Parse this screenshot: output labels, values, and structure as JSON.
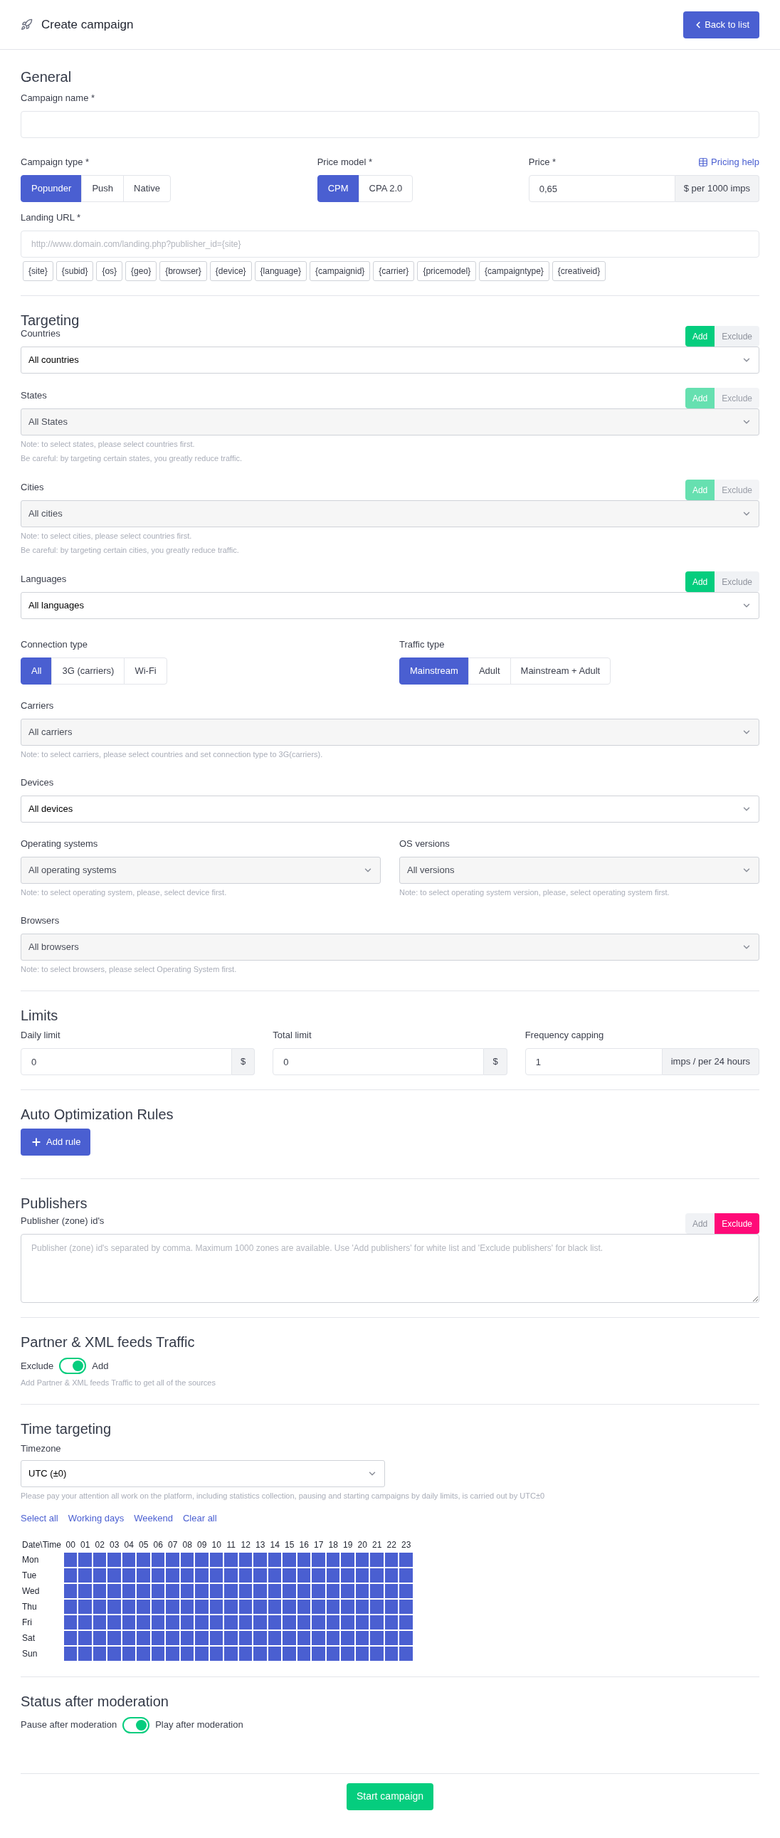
{
  "header": {
    "title": "Create campaign",
    "back_button": "Back to list"
  },
  "general": {
    "heading": "General",
    "campaign_name": {
      "label": "Campaign name *"
    },
    "campaign_type": {
      "label": "Campaign type *",
      "options": [
        {
          "label": "Popunder",
          "selected": true
        },
        {
          "label": "Push",
          "selected": false
        },
        {
          "label": "Native",
          "selected": false
        }
      ]
    },
    "price_model": {
      "label": "Price model *",
      "options": [
        {
          "label": "CPM",
          "selected": true
        },
        {
          "label": "CPA 2.0",
          "selected": false
        }
      ]
    },
    "price": {
      "label": "Price *",
      "help_link": "Pricing help",
      "value": "0,65",
      "suffix": "$ per 1000 imps"
    },
    "landing_url": {
      "label": "Landing URL *",
      "placeholder": "http://www.domain.com/landing.php?publisher_id={site}",
      "macros": [
        "{site}",
        "{subid}",
        "{os}",
        "{geo}",
        "{browser}",
        "{device}",
        "{language}",
        "{campaignid}",
        "{carrier}",
        "{pricemodel}",
        "{campaigntype}",
        "{creativeid}"
      ]
    }
  },
  "targeting": {
    "heading": "Targeting",
    "rows": [
      {
        "kind": "select",
        "label": "Countries",
        "value": "All countries",
        "disabled": false,
        "modes": [
          {
            "label": "Add",
            "selected": true
          },
          {
            "label": "Exclude",
            "selected": false
          }
        ]
      },
      {
        "kind": "select",
        "label": "States",
        "value": "All States",
        "disabled": true,
        "modes": [
          {
            "label": "Add",
            "selected": true
          },
          {
            "label": "Exclude",
            "selected": false
          }
        ],
        "notes": [
          "Note: to select states, please select countries first.",
          "Be careful: by targeting certain states, you greatly reduce traffic."
        ]
      },
      {
        "kind": "select",
        "label": "Cities",
        "value": "All cities",
        "disabled": true,
        "modes": [
          {
            "label": "Add",
            "selected": true
          },
          {
            "label": "Exclude",
            "selected": false
          }
        ],
        "notes": [
          "Note: to select cities, please select countries first.",
          "Be careful: by targeting certain cities, you greatly reduce traffic."
        ]
      },
      {
        "kind": "select",
        "label": "Languages",
        "value": "All languages",
        "disabled": false,
        "modes": [
          {
            "label": "Add",
            "selected": true
          },
          {
            "label": "Exclude",
            "selected": false
          }
        ]
      },
      {
        "kind": "segments",
        "groups": [
          {
            "label": "Connection type",
            "options": [
              {
                "label": "All",
                "selected": true
              },
              {
                "label": "3G (carriers)",
                "selected": false
              },
              {
                "label": "Wi-Fi",
                "selected": false
              }
            ]
          },
          {
            "label": "Traffic type",
            "options": [
              {
                "label": "Mainstream",
                "selected": true
              },
              {
                "label": "Adult",
                "selected": false
              },
              {
                "label": "Mainstream + Adult",
                "selected": false
              }
            ]
          }
        ]
      },
      {
        "kind": "select",
        "label": "Carriers",
        "value": "All carriers",
        "disabled": true,
        "notes": [
          "Note: to select carriers, please select countries and set connection type to 3G(carriers)."
        ]
      },
      {
        "kind": "select",
        "label": "Devices",
        "value": "All devices",
        "disabled": false
      },
      {
        "kind": "select_pair",
        "selects": [
          {
            "label": "Operating systems",
            "value": "All operating systems",
            "disabled": true,
            "notes": [
              "Note: to select operating system, please, select device first."
            ]
          },
          {
            "label": "OS versions",
            "value": "All versions",
            "disabled": true,
            "notes": [
              "Note: to select operating system version, please, select operating system first."
            ]
          }
        ]
      },
      {
        "kind": "select",
        "label": "Browsers",
        "value": "All browsers",
        "disabled": true,
        "notes": [
          "Note: to select browsers, please select Operating System first."
        ]
      }
    ]
  },
  "limits": {
    "heading": "Limits",
    "fields": [
      {
        "label": "Daily limit",
        "value": "0",
        "suffix": "$"
      },
      {
        "label": "Total limit",
        "value": "0",
        "suffix": "$"
      },
      {
        "label": "Frequency capping",
        "value": "1",
        "suffix": "imps / per 24 hours"
      }
    ]
  },
  "auto_optimization": {
    "heading": "Auto Optimization Rules",
    "button": "Add rule"
  },
  "publishers": {
    "heading": "Publishers",
    "label": "Publisher (zone) id's",
    "modes": [
      {
        "label": "Add",
        "selected": false
      },
      {
        "label": "Exclude",
        "selected": true
      }
    ],
    "placeholder": "Publisher (zone) id's separated by comma. Maximum 1000 zones are available. Use 'Add publishers' for white list and 'Exclude publishers' for black list."
  },
  "partner_feeds": {
    "heading": "Partner & XML feeds Traffic",
    "off_label": "Exclude",
    "on_label": "Add",
    "on": true,
    "note": "Add Partner & XML feeds Traffic to get all of the sources"
  },
  "time_targeting": {
    "heading": "Time targeting",
    "timezone": {
      "label": "Timezone",
      "value": "UTC (±0)"
    },
    "note": "Please pay your attention all work on the platform, including statistics collection, pausing and starting campaigns by daily limits, is carried out by UTC±0",
    "links": [
      "Select all",
      "Working days",
      "Weekend",
      "Clear all"
    ],
    "grid": {
      "corner": "Date\\Time",
      "hours": [
        "00",
        "01",
        "02",
        "03",
        "04",
        "05",
        "06",
        "07",
        "08",
        "09",
        "10",
        "11",
        "12",
        "13",
        "14",
        "15",
        "16",
        "17",
        "18",
        "19",
        "20",
        "21",
        "22",
        "23"
      ],
      "rows": [
        {
          "day": "Mon",
          "selected": [
            true,
            true,
            true,
            true,
            true,
            true,
            true,
            true,
            true,
            true,
            true,
            true,
            true,
            true,
            true,
            true,
            true,
            true,
            true,
            true,
            true,
            true,
            true,
            true
          ]
        },
        {
          "day": "Tue",
          "selected": [
            true,
            true,
            true,
            true,
            true,
            true,
            true,
            true,
            true,
            true,
            true,
            true,
            true,
            true,
            true,
            true,
            true,
            true,
            true,
            true,
            true,
            true,
            true,
            true
          ]
        },
        {
          "day": "Wed",
          "selected": [
            true,
            true,
            true,
            true,
            true,
            true,
            true,
            true,
            true,
            true,
            true,
            true,
            true,
            true,
            true,
            true,
            true,
            true,
            true,
            true,
            true,
            true,
            true,
            true
          ]
        },
        {
          "day": "Thu",
          "selected": [
            true,
            true,
            true,
            true,
            true,
            true,
            true,
            true,
            true,
            true,
            true,
            true,
            true,
            true,
            true,
            true,
            true,
            true,
            true,
            true,
            true,
            true,
            true,
            true
          ]
        },
        {
          "day": "Fri",
          "selected": [
            true,
            true,
            true,
            true,
            true,
            true,
            true,
            true,
            true,
            true,
            true,
            true,
            true,
            true,
            true,
            true,
            true,
            true,
            true,
            true,
            true,
            true,
            true,
            true
          ]
        },
        {
          "day": "Sat",
          "selected": [
            true,
            true,
            true,
            true,
            true,
            true,
            true,
            true,
            true,
            true,
            true,
            true,
            true,
            true,
            true,
            true,
            true,
            true,
            true,
            true,
            true,
            true,
            true,
            true
          ]
        },
        {
          "day": "Sun",
          "selected": [
            true,
            true,
            true,
            true,
            true,
            true,
            true,
            true,
            true,
            true,
            true,
            true,
            true,
            true,
            true,
            true,
            true,
            true,
            true,
            true,
            true,
            true,
            true,
            true
          ]
        }
      ]
    }
  },
  "status_after_moderation": {
    "heading": "Status after moderation",
    "off_label": "Pause after moderation",
    "on_label": "Play after moderation",
    "on": true
  },
  "submit_button": "Start campaign"
}
